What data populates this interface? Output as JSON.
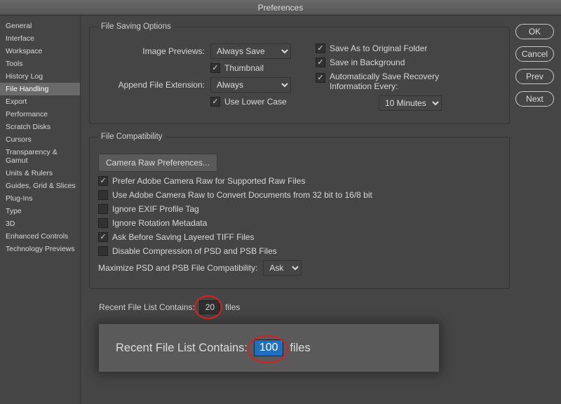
{
  "window": {
    "title": "Preferences"
  },
  "buttons": {
    "ok": "OK",
    "cancel": "Cancel",
    "prev": "Prev",
    "next": "Next"
  },
  "sidebar": {
    "items": [
      "General",
      "Interface",
      "Workspace",
      "Tools",
      "History Log",
      "File Handling",
      "Export",
      "Performance",
      "Scratch Disks",
      "Cursors",
      "Transparency & Gamut",
      "Units & Rulers",
      "Guides, Grid & Slices",
      "Plug-Ins",
      "Type",
      "3D",
      "Enhanced Controls",
      "Technology Previews"
    ],
    "activeIndex": 5
  },
  "saving": {
    "legend": "File Saving Options",
    "imagePreviewsLabel": "Image Previews:",
    "imagePreviewsValue": "Always Save",
    "thumbnailLabel": "Thumbnail",
    "thumbnailChecked": true,
    "saveAsOriginalLabel": "Save As to Original Folder",
    "saveAsOriginalChecked": true,
    "saveBgLabel": "Save in Background",
    "saveBgChecked": true,
    "appendExtLabel": "Append File Extension:",
    "appendExtValue": "Always",
    "lowerCaseLabel": "Use Lower Case",
    "lowerCaseChecked": true,
    "autoRecoveryLabel": "Automatically Save Recovery Information Every:",
    "autoRecoveryChecked": true,
    "autoRecoveryInterval": "10 Minutes"
  },
  "compat": {
    "legend": "File Compatibility",
    "camRawBtn": "Camera Raw Preferences...",
    "preferACR": {
      "label": "Prefer Adobe Camera Raw for Supported Raw Files",
      "checked": true
    },
    "useACR32": {
      "label": "Use Adobe Camera Raw to Convert Documents from 32 bit to 16/8 bit",
      "checked": false
    },
    "ignoreEXIF": {
      "label": "Ignore EXIF Profile Tag",
      "checked": false
    },
    "ignoreRot": {
      "label": "Ignore Rotation Metadata",
      "checked": false
    },
    "askTIFF": {
      "label": "Ask Before Saving Layered TIFF Files",
      "checked": true
    },
    "disablePSD": {
      "label": "Disable Compression of PSD and PSB Files",
      "checked": false
    },
    "maximizeLabel": "Maximize PSD and PSB File Compatibility:",
    "maximizeValue": "Ask"
  },
  "recent": {
    "label": "Recent File List Contains:",
    "value": "20",
    "suffix": "files",
    "callout": {
      "label": "Recent File List Contains:",
      "value": "100",
      "suffix": "files"
    }
  }
}
